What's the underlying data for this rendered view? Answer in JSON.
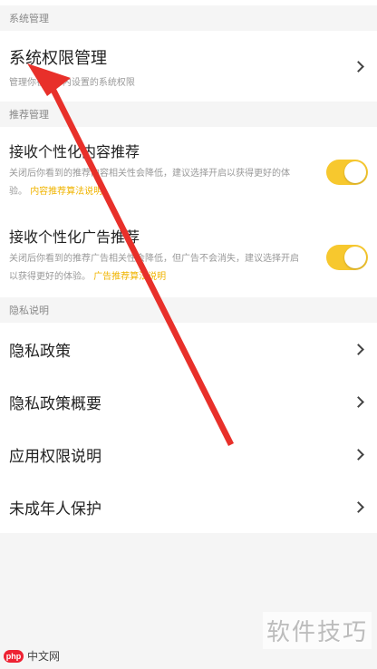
{
  "sections": {
    "system": {
      "header": "系统管理",
      "row": {
        "title": "系统权限管理",
        "subtitle": "管理你在APP内设置的系统权限"
      }
    },
    "recommend": {
      "header": "推荐管理",
      "items": [
        {
          "title": "接收个性化内容推荐",
          "desc": "关闭后你看到的推荐内容相关性会降低，建议选择开启以获得更好的体验。",
          "link": "内容推荐算法说明",
          "enabled": true
        },
        {
          "title": "接收个性化广告推荐",
          "desc": "关闭后你看到的推荐广告相关性会降低，但广告不会消失，建议选择开启以获得更好的体验。",
          "link": "广告推荐算法说明",
          "enabled": true
        }
      ]
    },
    "privacy": {
      "header": "隐私说明",
      "items": [
        {
          "label": "隐私政策"
        },
        {
          "label": "隐私政策概要"
        },
        {
          "label": "应用权限说明"
        },
        {
          "label": "未成年人保护"
        }
      ]
    }
  },
  "watermarks": {
    "right": "软件技巧",
    "left_logo": "php",
    "left_text": "中文网"
  },
  "colors": {
    "accent": "#f7c82e",
    "annotation_arrow": "#e8302a"
  },
  "icons": {
    "chevron": "chevron-right-icon",
    "annotation": "red-arrow-annotation"
  }
}
